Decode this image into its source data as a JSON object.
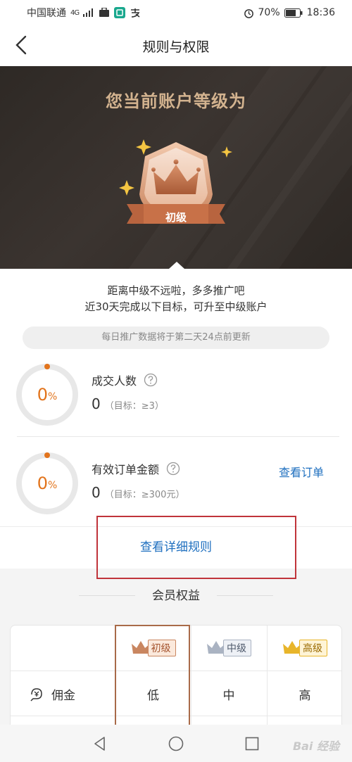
{
  "status": {
    "carrier": "中国联通",
    "net": "4G",
    "battery": "70%",
    "time": "18:36"
  },
  "appbar": {
    "title": "规则与权限"
  },
  "hero": {
    "title": "您当前账户等级为",
    "level": "初级"
  },
  "goal": {
    "line1": "距离中级不远啦，多多推广吧",
    "line2": "近30天完成以下目标，可升至中级账户",
    "notice": "每日推广数据将于第二天24点前更新"
  },
  "metrics": [
    {
      "label": "成交人数",
      "pct": "0",
      "pct_suffix": "%",
      "value": "0",
      "target": "（目标：≥3）",
      "link": ""
    },
    {
      "label": "有效订单金额",
      "pct": "0",
      "pct_suffix": "%",
      "value": "0",
      "target": "（目标：≥300元）",
      "link": "查看订单"
    }
  ],
  "rules_link": "查看详细规则",
  "benefits": {
    "title": "会员权益",
    "levels": [
      "初级",
      "中级",
      "高级"
    ],
    "rows": [
      {
        "label": "佣金",
        "values": [
          "低",
          "中",
          "高"
        ]
      }
    ]
  },
  "watermark": "Bai 经验",
  "colors": {
    "accent": "#e2741c",
    "link": "#1e6fbf",
    "highlight_border": "#c0343a",
    "bronze": "#a86a49"
  }
}
